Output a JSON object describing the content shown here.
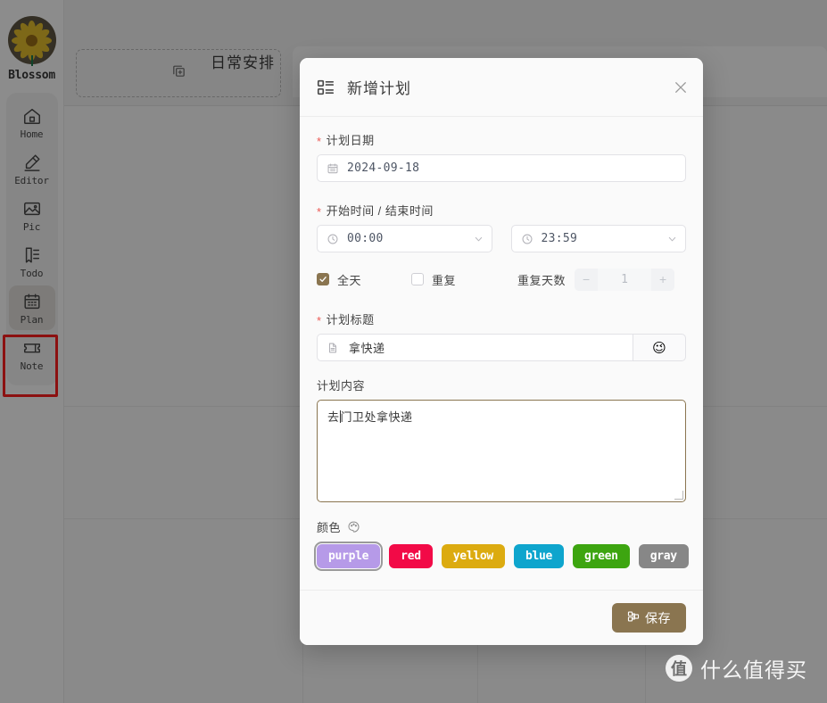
{
  "sidebar": {
    "brand": "Blossom",
    "items": [
      {
        "label": "Home",
        "icon": "home-icon",
        "active": false
      },
      {
        "label": "Editor",
        "icon": "pen-icon",
        "active": false
      },
      {
        "label": "Pic",
        "icon": "image-icon",
        "active": false
      },
      {
        "label": "Todo",
        "icon": "bookmark-icon",
        "active": false
      },
      {
        "label": "Plan",
        "icon": "calendar-icon",
        "active": true
      },
      {
        "label": "Note",
        "icon": "ticket-icon",
        "active": false
      }
    ]
  },
  "background": {
    "page_title": "日常安排",
    "add_card_icon": "copy-plus-icon",
    "menu_icon": "hamburger-icon"
  },
  "modal": {
    "header_icon": "list-icon",
    "title": "新增计划",
    "close_icon": "close-icon",
    "date": {
      "label": "计划日期",
      "required": true,
      "icon": "calendar-icon",
      "value": "2024-09-18"
    },
    "time": {
      "label": "开始时间 / 结束时间",
      "required": true,
      "start": {
        "icon": "clock-icon",
        "value": "00:00",
        "caret": "chevron-down-icon"
      },
      "end": {
        "icon": "clock-icon",
        "value": "23:59",
        "caret": "chevron-down-icon"
      }
    },
    "checkboxes": {
      "all_day": {
        "label": "全天",
        "checked": true
      },
      "repeat": {
        "label": "重复",
        "checked": false
      }
    },
    "repeat_days": {
      "label": "重复天数",
      "value": "1",
      "minus": "−",
      "plus": "+",
      "disabled": true
    },
    "plan_title": {
      "label": "计划标题",
      "required": true,
      "icon": "document-icon",
      "value": "拿快递",
      "emoji_button": "😉"
    },
    "plan_content": {
      "label": "计划内容",
      "required": false,
      "value": "去门卫处拿快递"
    },
    "color": {
      "label": "颜色",
      "icon": "palette-icon",
      "selected": "purple",
      "options": [
        {
          "name": "purple",
          "hex": "#b69ae8"
        },
        {
          "name": "red",
          "hex": "#f20a47"
        },
        {
          "name": "yellow",
          "hex": "#dcab10"
        },
        {
          "name": "blue",
          "hex": "#0ea5cd"
        },
        {
          "name": "green",
          "hex": "#3da510"
        },
        {
          "name": "gray",
          "hex": "#878787"
        }
      ]
    },
    "save": {
      "label": "保存",
      "icon": "save-icon"
    }
  },
  "theme": {
    "accent": "#8a7550",
    "required_star": "#ec5b56",
    "annotation": "#ff2020"
  },
  "watermark": {
    "logo": "值",
    "text": "什么值得买"
  }
}
